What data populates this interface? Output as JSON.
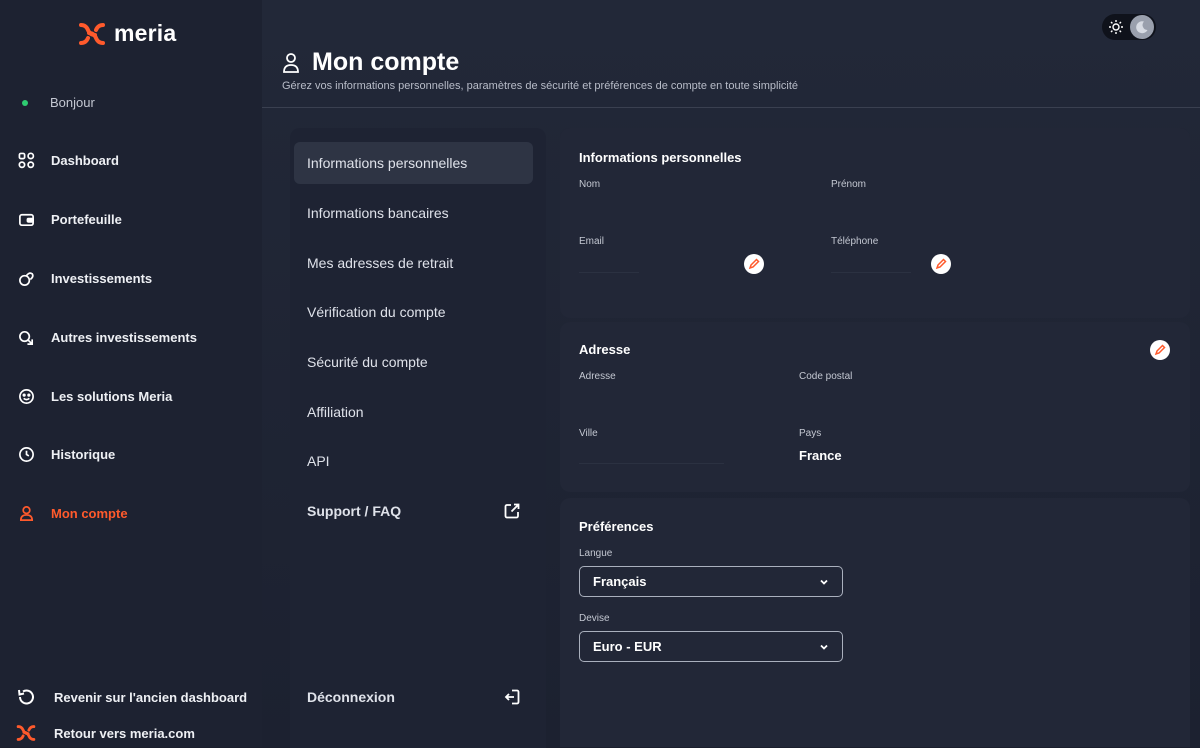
{
  "brand": {
    "name": "meria",
    "accent": "#ff5a2c"
  },
  "sidebar": {
    "greeting": "Bonjour",
    "items": [
      {
        "label": "Dashboard",
        "icon": "dashboard-icon"
      },
      {
        "label": "Portefeuille",
        "icon": "wallet-icon"
      },
      {
        "label": "Investissements",
        "icon": "investments-icon"
      },
      {
        "label": "Autres investissements",
        "icon": "other-investments-icon"
      },
      {
        "label": "Les solutions Meria",
        "icon": "solutions-icon"
      },
      {
        "label": "Historique",
        "icon": "clock-icon"
      },
      {
        "label": "Mon compte",
        "icon": "user-icon",
        "active": true
      }
    ],
    "bottom": [
      {
        "label": "Revenir sur l'ancien dashboard",
        "icon": "undo-icon"
      },
      {
        "label": "Retour vers meria.com",
        "icon": "meria-logo-icon"
      }
    ]
  },
  "header": {
    "title": "Mon compte",
    "subtitle": "Gérez vos informations personnelles, paramètres de sécurité et préférences de compte en toute simplicité"
  },
  "account_menu": {
    "items": [
      {
        "label": "Informations personnelles",
        "active": true
      },
      {
        "label": "Informations bancaires"
      },
      {
        "label": "Mes adresses de retrait"
      },
      {
        "label": "Vérification du compte"
      },
      {
        "label": "Sécurité du compte"
      },
      {
        "label": "Affiliation"
      },
      {
        "label": "API"
      },
      {
        "label": "Support / FAQ",
        "icon": "external-link-icon"
      }
    ],
    "logout": {
      "label": "Déconnexion",
      "icon": "logout-icon"
    }
  },
  "personal_info": {
    "title": "Informations personnelles",
    "fields": {
      "nom": {
        "label": "Nom",
        "value": ""
      },
      "prenom": {
        "label": "Prénom",
        "value": ""
      },
      "email": {
        "label": "Email",
        "value": ""
      },
      "telephone": {
        "label": "Téléphone",
        "value": ""
      }
    }
  },
  "address": {
    "title": "Adresse",
    "fields": {
      "adresse": {
        "label": "Adresse",
        "value": ""
      },
      "code_postal": {
        "label": "Code postal",
        "value": ""
      },
      "ville": {
        "label": "Ville",
        "value": ""
      },
      "pays": {
        "label": "Pays",
        "value": "France"
      }
    }
  },
  "preferences": {
    "title": "Préférences",
    "langue": {
      "label": "Langue",
      "value": "Français"
    },
    "devise": {
      "label": "Devise",
      "value": "Euro - EUR"
    }
  }
}
